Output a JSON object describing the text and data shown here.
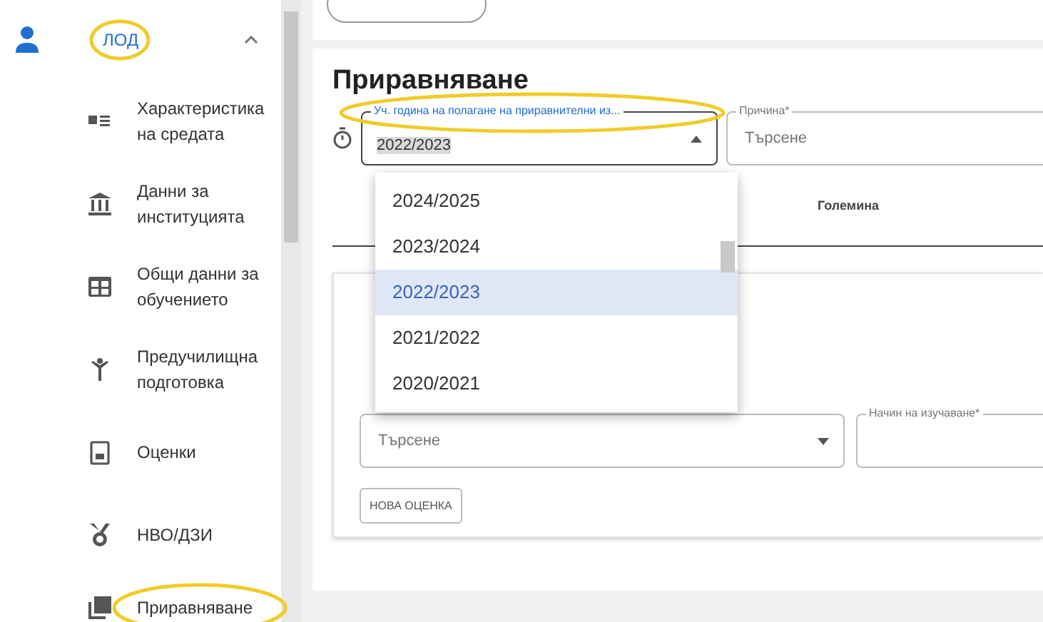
{
  "sidebar": {
    "group": {
      "label": "ЛОД",
      "expanded": true,
      "highlighted": true
    },
    "items": [
      {
        "label": "Характеристика на средата",
        "kind": "list",
        "highlighted": false
      },
      {
        "label": "Данни за институцията",
        "kind": "bank",
        "highlighted": false
      },
      {
        "label": "Общи данни за обучението",
        "kind": "grid",
        "highlighted": false
      },
      {
        "label": "Предучилищна подготовка",
        "kind": "child",
        "highlighted": false
      },
      {
        "label": "Оценки",
        "kind": "clipboard",
        "highlighted": false
      },
      {
        "label": "НВО/ДЗИ",
        "kind": "medal",
        "highlighted": false
      },
      {
        "label": "Приравняване",
        "kind": "copy",
        "highlighted": true
      }
    ]
  },
  "section": {
    "title": "Приравняване",
    "year_field": {
      "label": "Уч. година на полагане на приравнителни из...",
      "value": "2022/2023",
      "label_highlighted": true
    },
    "reason_field": {
      "label": "Причина*",
      "placeholder": "Търсене"
    },
    "table": {
      "columns": [
        "Големина"
      ]
    },
    "dropdown": {
      "options": [
        {
          "label": "2024/2025",
          "selected": false
        },
        {
          "label": "2023/2024",
          "selected": false
        },
        {
          "label": "2022/2023",
          "selected": true
        },
        {
          "label": "2021/2022",
          "selected": false
        },
        {
          "label": "2020/2021",
          "selected": false
        }
      ]
    },
    "subject_field": {
      "placeholder": "Търсене"
    },
    "method_field": {
      "label": "Начин на изучаване*"
    },
    "button": "НОВА ОЦЕНКА"
  }
}
